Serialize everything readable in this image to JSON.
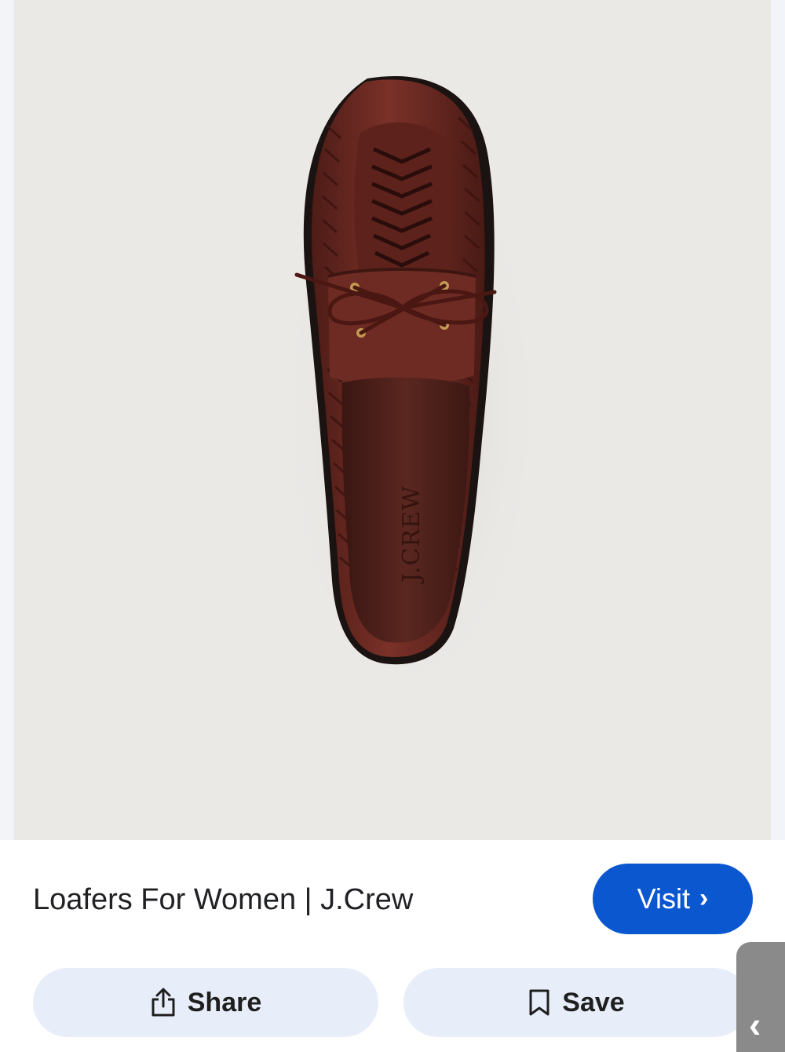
{
  "image": {
    "alt": "Loafers For Women | J.Crew",
    "insole_brand": "J.CREW",
    "background_color": "#ebe9e6",
    "shoe_color": "#6b2a22"
  },
  "result": {
    "title": "Loafers For Women | J.Crew"
  },
  "actions": {
    "visit_label": "Visit",
    "visit_icon": "chevron-right-icon",
    "share_label": "Share",
    "share_icon": "share-icon",
    "save_label": "Save",
    "save_icon": "bookmark-icon"
  },
  "colors": {
    "accent": "#0b57d0",
    "chip_background": "#e8eef9",
    "text": "#202124"
  }
}
